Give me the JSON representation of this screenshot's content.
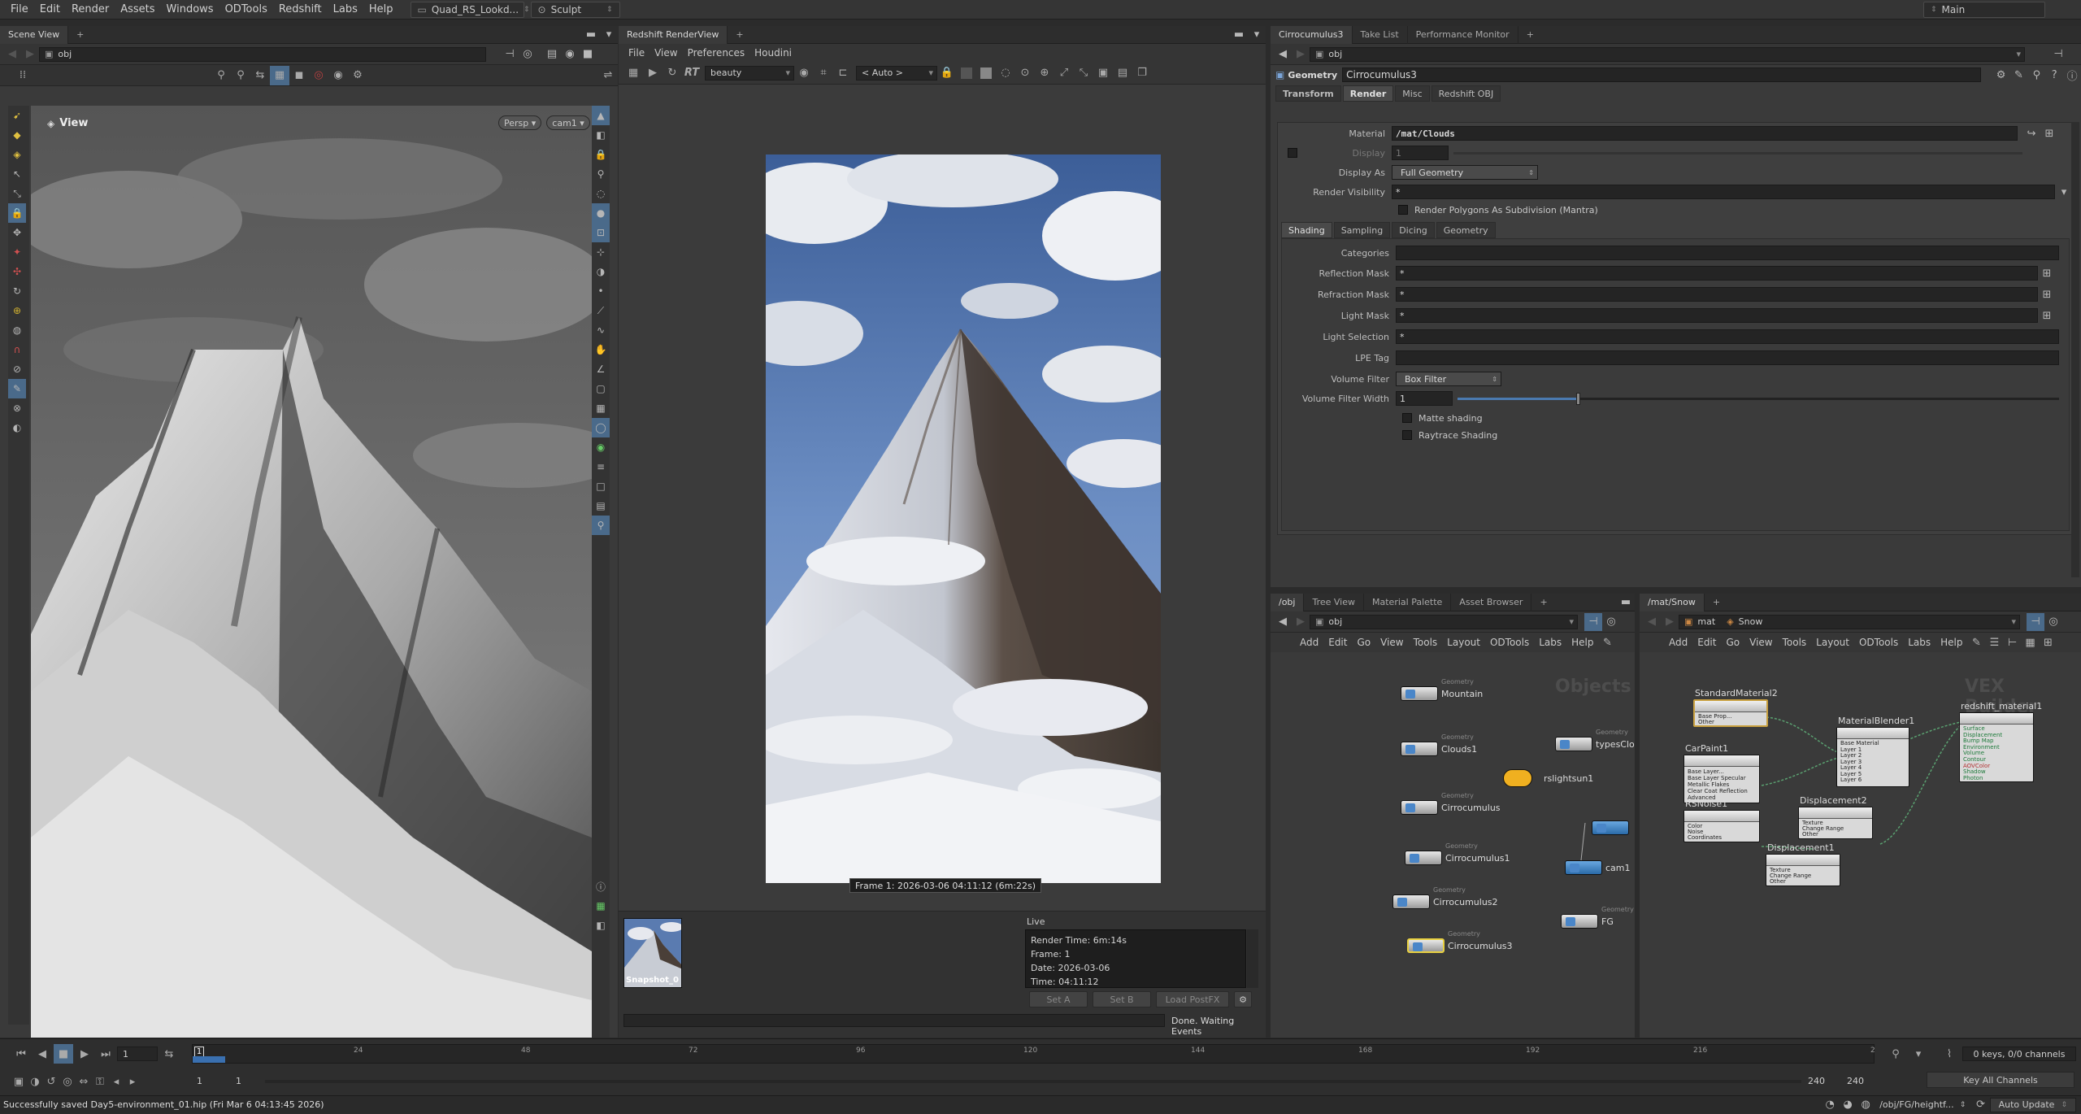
{
  "menubar": {
    "items": [
      "File",
      "Edit",
      "Render",
      "Assets",
      "Windows",
      "ODTools",
      "Redshift",
      "Labs",
      "Help"
    ],
    "desktop": "Quad_RS_Lookd...",
    "workspace": "Sculpt",
    "main": "Main"
  },
  "scene_view": {
    "tab": "Scene View",
    "path": "obj",
    "view_label": "View",
    "persp": "Persp",
    "camera": "cam1"
  },
  "render_view": {
    "tab": "Redshift RenderView",
    "menu": [
      "File",
      "View",
      "Preferences",
      "Houdini"
    ],
    "aov": "beauty",
    "auto": "< Auto >",
    "frame_caption": "Frame  1:  2026-03-06  04:11:12  (6m:22s)",
    "snapshot_label": "Snapshot_0",
    "live_label": "Live",
    "stats": [
      "Render Time: 6m:14s",
      "Frame: 1",
      "Date: 2026-03-06",
      "Time: 04:11:12"
    ],
    "buttons": [
      "Set A",
      "Set B",
      "Load PostFX"
    ],
    "status": "Done. Waiting Events"
  },
  "param_pane": {
    "tabs": [
      "Cirrocumulus3",
      "Take List",
      "Performance Monitor"
    ],
    "path": "obj",
    "node_type": "Geometry",
    "node_name": "Cirrocumulus3",
    "top_tabs": [
      "Transform",
      "Render",
      "Misc",
      "Redshift OBJ"
    ],
    "material_label": "Material",
    "material_value": "/mat/Clouds",
    "display_label": "Display",
    "display_value": "1",
    "display_as_label": "Display As",
    "display_as_value": "Full Geometry",
    "render_visibility_label": "Render Visibility",
    "render_visibility_value": "*",
    "render_polygons_label": "Render Polygons As Subdivision (Mantra)",
    "sub_tabs": [
      "Shading",
      "Sampling",
      "Dicing",
      "Geometry"
    ],
    "categories_label": "Categories",
    "reflection_label": "Reflection Mask",
    "reflection_value": "*",
    "refraction_label": "Refraction Mask",
    "refraction_value": "*",
    "light_mask_label": "Light Mask",
    "light_mask_value": "*",
    "light_selection_label": "Light Selection",
    "light_selection_value": "*",
    "lpe_label": "LPE Tag",
    "volume_filter_label": "Volume Filter",
    "volume_filter_value": "Box Filter",
    "volume_filter_width_label": "Volume Filter Width",
    "volume_filter_width_value": "1",
    "matte_label": "Matte shading",
    "raytrace_label": "Raytrace Shading"
  },
  "obj_network": {
    "tabs": [
      "/obj",
      "Tree View",
      "Material Palette",
      "Asset Browser"
    ],
    "path": "obj",
    "menu": [
      "Add",
      "Edit",
      "Go",
      "View",
      "Tools",
      "Layout",
      "ODTools",
      "Labs",
      "Help"
    ],
    "watermark": "Objects",
    "nodes": [
      {
        "name": "Mountain",
        "type": "Geometry"
      },
      {
        "name": "Clouds1",
        "type": "Geometry"
      },
      {
        "name": "typesClou",
        "type": "Geometry"
      },
      {
        "name": "rslightsun1",
        "type": ""
      },
      {
        "name": "Cirrocumulus",
        "type": "Geometry"
      },
      {
        "name": "Cirrocumulus1",
        "type": "Geometry"
      },
      {
        "name": "cam1",
        "type": ""
      },
      {
        "name": "Cirrocumulus2",
        "type": "Geometry"
      },
      {
        "name": "FG",
        "type": "Geometry"
      },
      {
        "name": "Cirrocumulus3",
        "type": "Geometry"
      }
    ]
  },
  "mat_network": {
    "tabs": [
      "/mat/Snow"
    ],
    "path_root": "mat",
    "path_node": "Snow",
    "menu": [
      "Add",
      "Edit",
      "Go",
      "View",
      "Tools",
      "Layout",
      "ODTools",
      "Labs",
      "Help"
    ],
    "watermark": "VEX Builder",
    "nodes": [
      {
        "name": "StandardMaterial2",
        "rows": [
          "Base Prop...",
          "Other"
        ]
      },
      {
        "name": "MaterialBlender1",
        "rows": [
          "Base Material",
          "Layer 1",
          "Layer 2",
          "Layer 3",
          "Layer 4",
          "Layer 5",
          "Layer 6"
        ]
      },
      {
        "name": "redshift_material1",
        "rows": [
          "Surface",
          "Displacement",
          "Bump Map",
          "Environment",
          "Volume",
          "Contour",
          "AOVColor",
          "Shadow",
          "Photon"
        ]
      },
      {
        "name": "CarPaint1",
        "rows": [
          "Base Layer...",
          "Base Layer Specular",
          "Metallic Flakes",
          "Clear Coat Reflection",
          "Advanced"
        ]
      },
      {
        "name": "RSNoise1",
        "rows": [
          "Color",
          "Noise",
          "Coordinates"
        ]
      },
      {
        "name": "Displacement2",
        "rows": [
          "Texture",
          "Change Range",
          "Other"
        ]
      },
      {
        "name": "Displacement1",
        "rows": [
          "Texture",
          "Change Range",
          "Other"
        ]
      }
    ]
  },
  "timeline": {
    "frame": "1",
    "ticks": [
      "24",
      "48",
      "72",
      "96",
      "120",
      "144",
      "168",
      "192",
      "216",
      "2"
    ],
    "start": "1",
    "start2": "1",
    "end": "240",
    "end2": "240",
    "keys": "0 keys, 0/0 channels",
    "key_all": "Key All Channels"
  },
  "statusbar": {
    "message": "Successfully saved Day5-environment_01.hip (Fri Mar  6 04:13:45 2026)",
    "path": "/obj/FG/heightf...",
    "auto_update": "Auto Update"
  }
}
